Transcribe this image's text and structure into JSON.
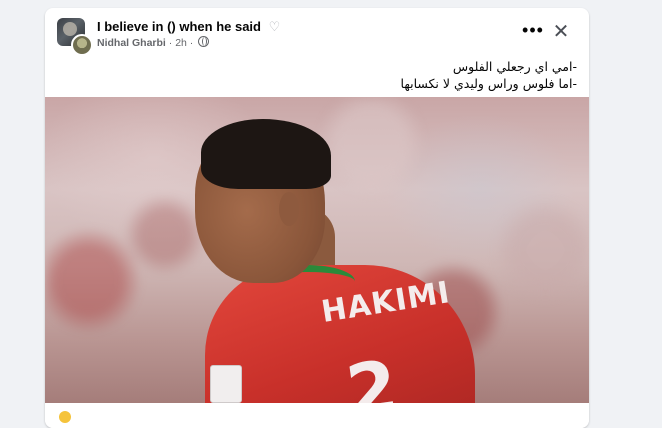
{
  "post": {
    "group_title": "I believe in () when he said",
    "author": "Nidhal Gharbi",
    "time": "2h",
    "separator": "·",
    "body_lines": [
      "-امي اي رجعلي الفلوس",
      "-اما فلوس وراس وليدي لا نكسابها"
    ]
  },
  "photo": {
    "jersey_name": "HAKIMI",
    "jersey_number": "2"
  },
  "icons": {
    "heart": "heart-outline-icon",
    "more": "more-horizontal-icon",
    "close": "close-icon",
    "privacy": "globe-icon"
  },
  "colors": {
    "page_bg": "#f0f2f5",
    "card_bg": "#ffffff",
    "text_primary": "#050505",
    "text_secondary": "#65676b"
  },
  "glyphs": {
    "heart": "♡",
    "more": "•••",
    "close": "✕"
  }
}
